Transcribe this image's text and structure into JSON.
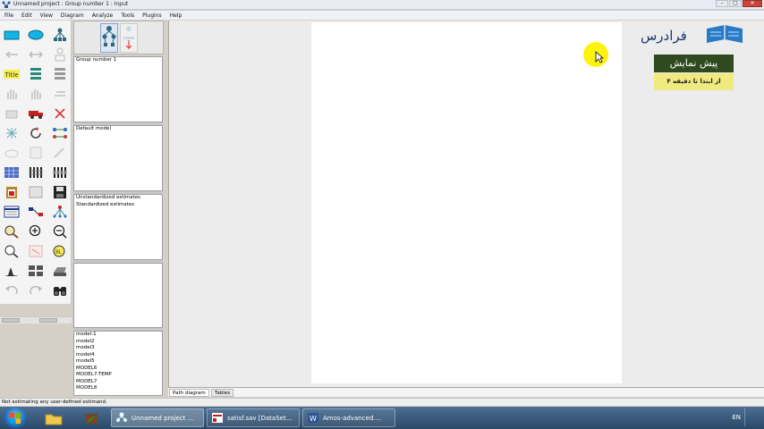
{
  "window": {
    "title": "Unnamed project : Group number 1 : Input"
  },
  "menu": [
    "File",
    "Edit",
    "View",
    "Diagram",
    "Analyze",
    "Tools",
    "Plugins",
    "Help"
  ],
  "panels": {
    "groups": [
      "Group number 1"
    ],
    "models": [
      "Default model"
    ],
    "estimates": [
      "Unstandardized estimates",
      "Standardized estimates"
    ],
    "model_list": [
      "model-1",
      "model2",
      "model3",
      "model4",
      "model5",
      "MODEL6",
      "MODEL7-TEMP",
      "MODEL7",
      "MODEL8"
    ]
  },
  "canvas": {
    "tabs": [
      "Path diagram",
      "Tables"
    ]
  },
  "watermark": {
    "logo_text": "فرادرس",
    "title": "پیش نمایش",
    "subtitle": "از ابتدا تا دقیقه ۴"
  },
  "status": {
    "text": "Not estimating any user-defined estimand."
  },
  "taskbar": {
    "tasks": [
      "Unnamed project ...",
      "satisf.sav [DataSet...",
      "Amos-advanced...."
    ],
    "language": "EN"
  },
  "colors": {
    "cursor_highlight": "#fff200",
    "watermark_title_bg": "#2f4a1f",
    "watermark_sub_bg": "#f1ea80"
  }
}
